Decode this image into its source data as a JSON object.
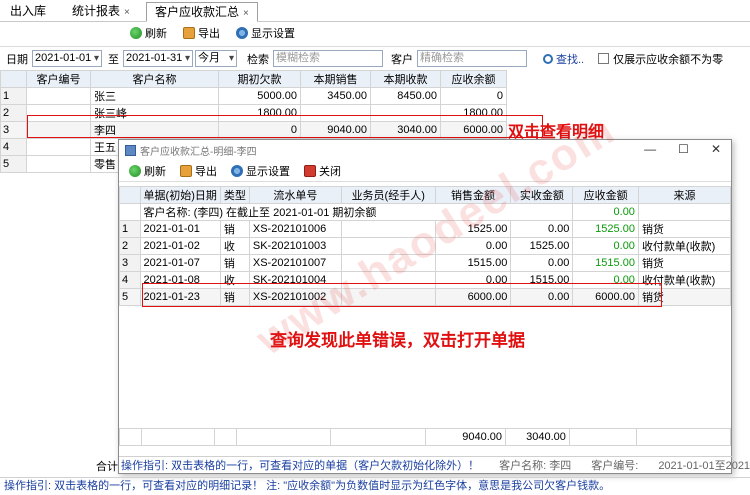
{
  "tabs": [
    {
      "label": "出入库"
    },
    {
      "label": "统计报表",
      "close": "×"
    },
    {
      "label": "客户应收款汇总",
      "close": "×"
    }
  ],
  "toolbar": {
    "refresh": "刷新",
    "export": "导出",
    "settings": "显示设置"
  },
  "filter": {
    "date_label": "日期",
    "date_from": "2021-01-01",
    "to_label": "至",
    "date_to": "2021-01-31",
    "period": "今月",
    "search_label": "检索",
    "search_placeholder": "模糊检索",
    "customer_label": "客户",
    "customer_placeholder": "精确检索",
    "find_button": "查找..",
    "checkbox_label": "仅展示应收余额不为零"
  },
  "main_table": {
    "headers": [
      "客户编号",
      "客户名称",
      "期初欠款",
      "本期销售",
      "本期收款",
      "应收余额"
    ],
    "rows": [
      {
        "num": "1",
        "cells": [
          "",
          "张三",
          "5000.00",
          "3450.00",
          "8450.00",
          "0"
        ]
      },
      {
        "num": "2",
        "cells": [
          "",
          "张三峰",
          "1800.00",
          "",
          "",
          "1800.00"
        ]
      },
      {
        "num": "3",
        "cells": [
          "",
          "李四",
          "0",
          "9040.00",
          "3040.00",
          "6000.00"
        ]
      },
      {
        "num": "4",
        "cells": [
          "",
          "王五",
          "",
          "",
          "",
          ""
        ]
      },
      {
        "num": "5",
        "cells": [
          "",
          "零售",
          "",
          "",
          "",
          ""
        ]
      }
    ],
    "total_label": "合计"
  },
  "annotations": {
    "double_click_detail": "双击查看明细",
    "wrong_doc": "查询发现此单错误，双击打开单据"
  },
  "watermark": "www.haodeel.com",
  "detail": {
    "title": "客户应收款汇总-明细-李四",
    "win_min": "—",
    "win_max": "☐",
    "win_close": "✕",
    "toolbar": {
      "refresh": "刷新",
      "export": "导出",
      "settings": "显示设置",
      "close": "关闭"
    },
    "headers": [
      "单据(初始)日期",
      "类型",
      "流水单号",
      "业务员(经手人)",
      "销售金额",
      "实收金额",
      "应收金额",
      "来源"
    ],
    "opening_row": {
      "text": "客户名称: (李四) 在截止至 2021-01-01 期初余额",
      "balance": "0.00"
    },
    "rows": [
      {
        "num": "1",
        "cells": [
          "2021-01-01",
          "销",
          "XS-202101006",
          "",
          "1525.00",
          "0.00",
          "1525.00",
          "销货"
        ]
      },
      {
        "num": "2",
        "cells": [
          "2021-01-02",
          "收",
          "SK-202101003",
          "",
          "0.00",
          "1525.00",
          "0.00",
          "收付款单(收款)"
        ]
      },
      {
        "num": "3",
        "cells": [
          "2021-01-07",
          "销",
          "XS-202101007",
          "",
          "1515.00",
          "0.00",
          "1515.00",
          "销货"
        ]
      },
      {
        "num": "4",
        "cells": [
          "2021-01-08",
          "收",
          "SK-202101004",
          "",
          "0.00",
          "1515.00",
          "0.00",
          "收付款单(收款)"
        ]
      },
      {
        "num": "5",
        "cells": [
          "2021-01-23",
          "销",
          "XS-202101002",
          "",
          "6000.00",
          "0.00",
          "6000.00",
          "销货"
        ]
      }
    ],
    "sum_sales": "9040.00",
    "sum_received": "3040.00",
    "footer": {
      "hint": "操作指引: 双击表格的一行，可查看对应的单据（客户欠款初始化除外）！",
      "customer_name": "客户名称: 李四",
      "customer_code": "客户编号:",
      "range": "2021-01-01至2021-01-31"
    }
  },
  "statusbar": "操作指引: 双击表格的一行，可查看对应的明细记录！ 注: \"应收余额\"为负数值时显示为红色字体，意思是我公司欠客户钱款。",
  "colors": {
    "annotation": "#e01010",
    "positive_balance": "#0a9a0a",
    "hint_text": "#1a3fa0"
  }
}
